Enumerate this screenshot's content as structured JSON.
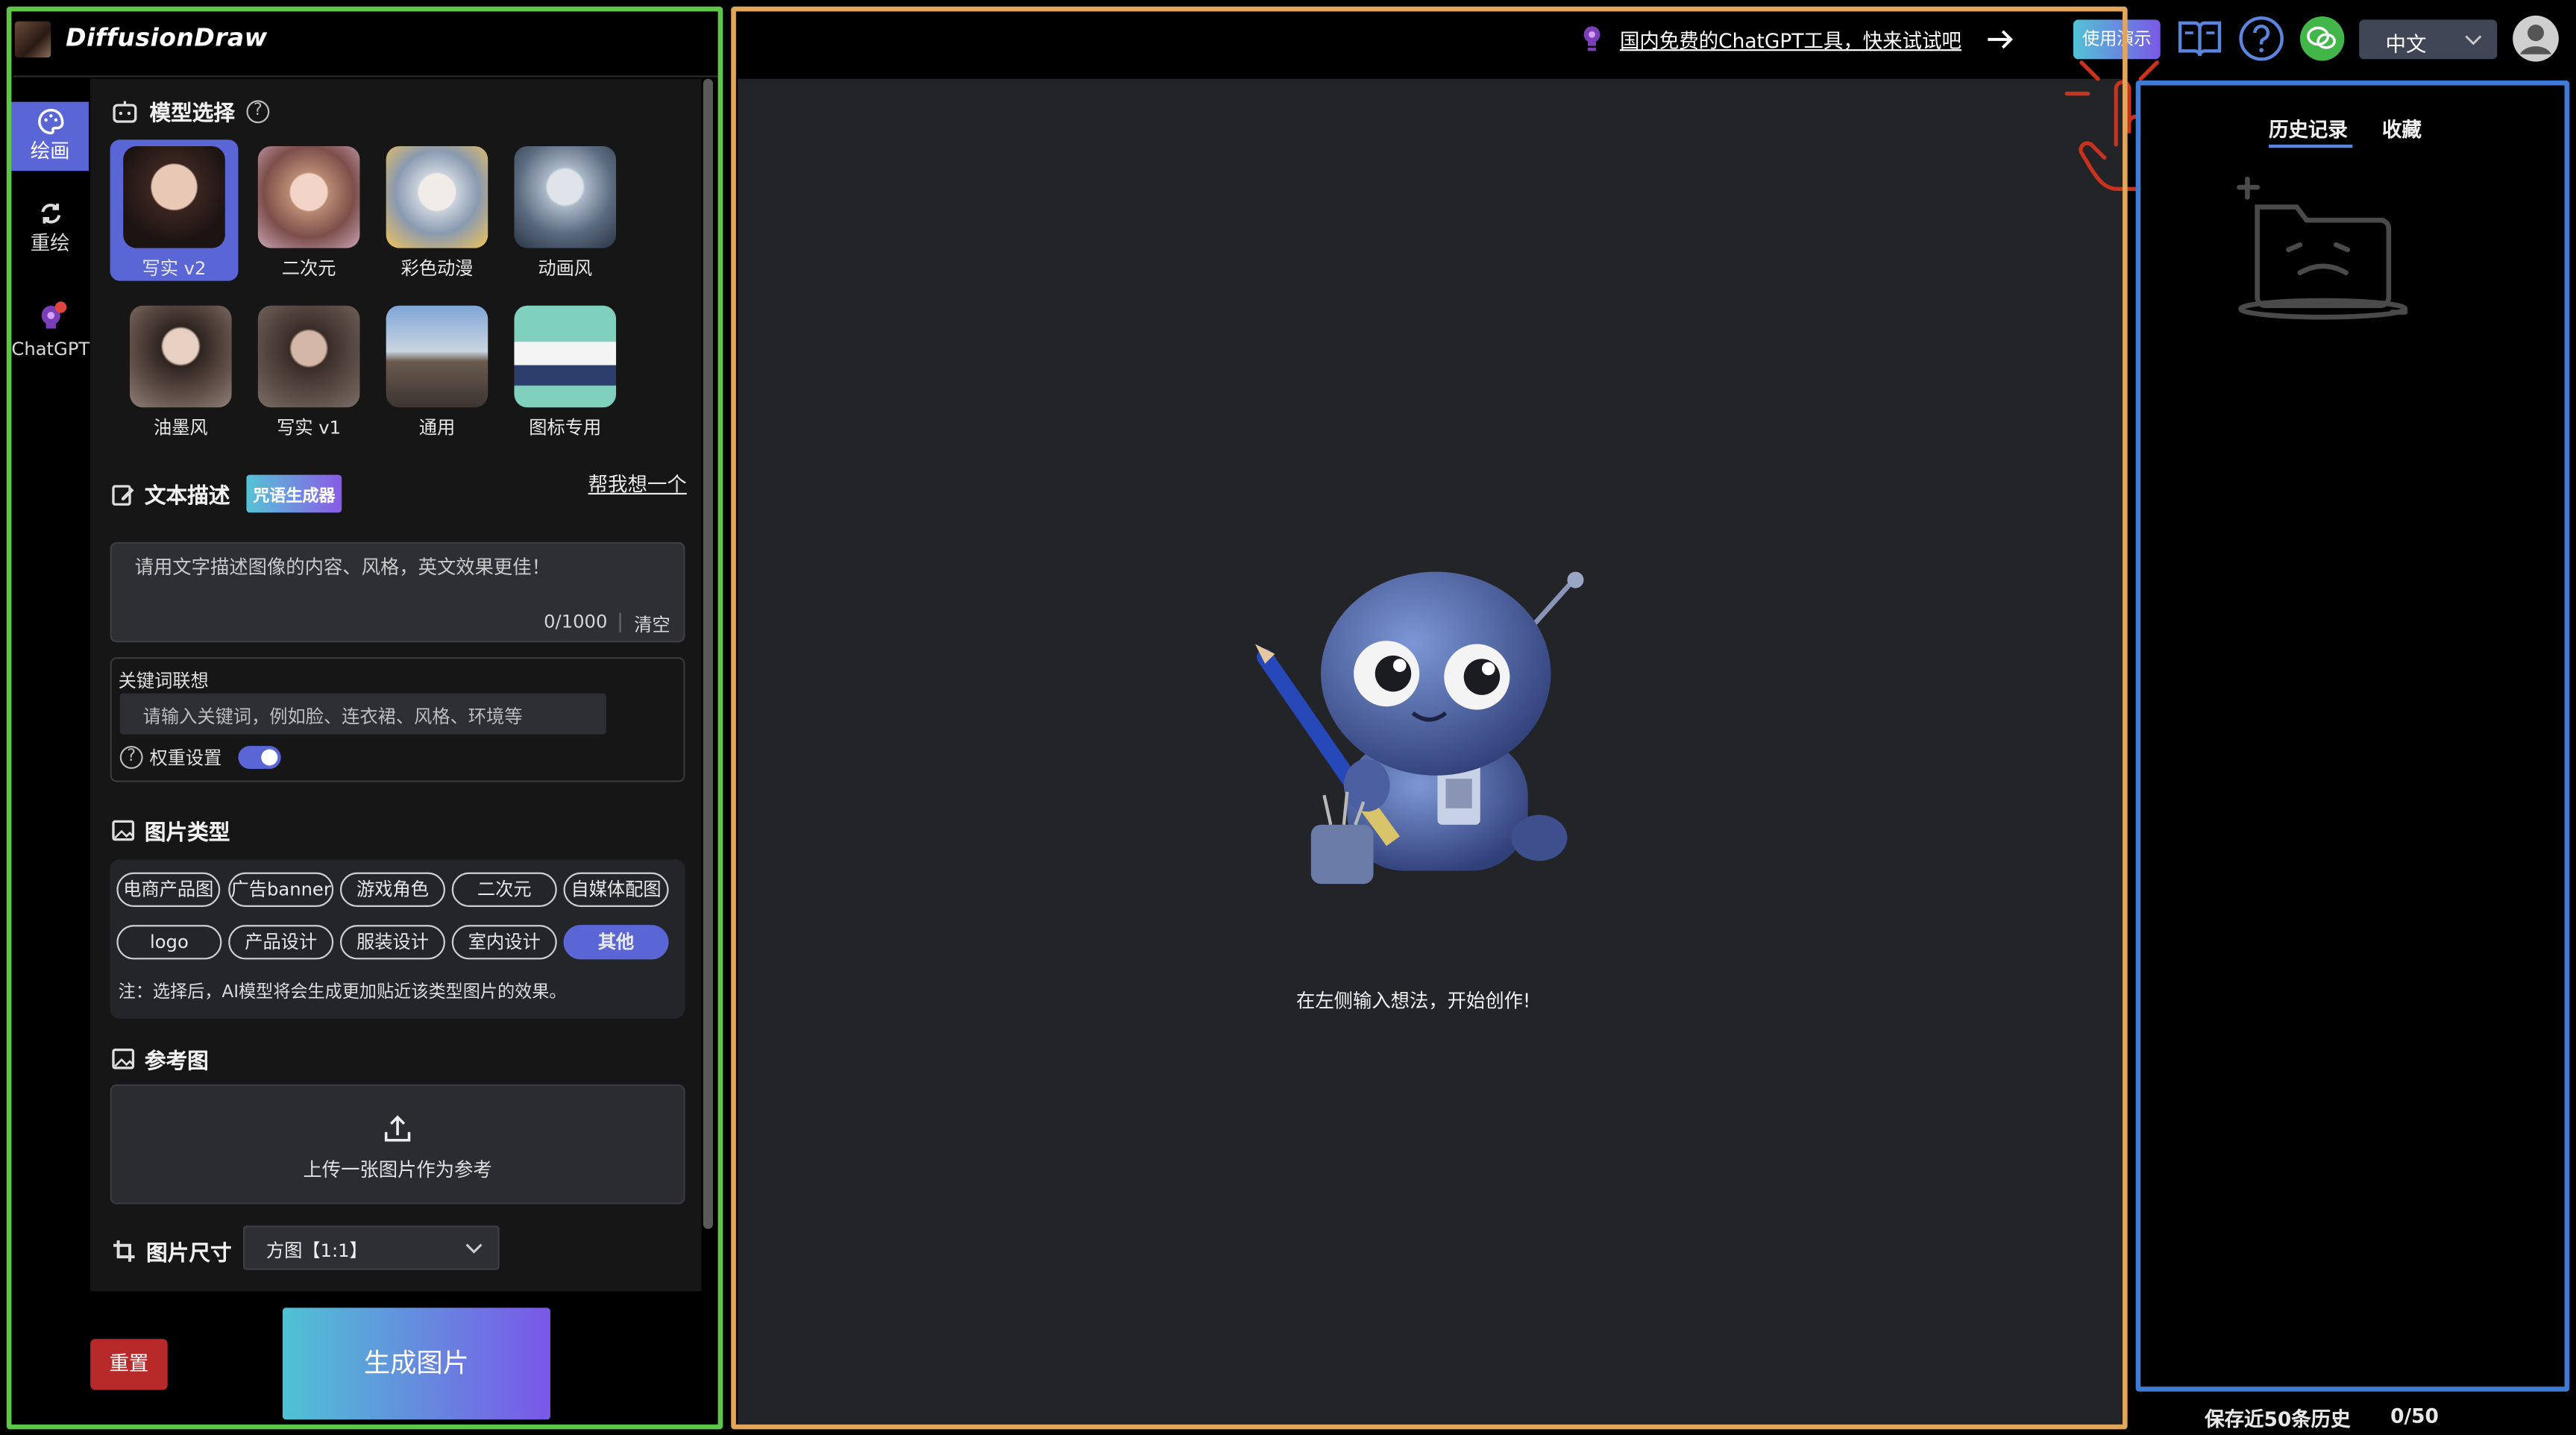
{
  "app": {
    "title": "DiffusionDraw"
  },
  "topbar": {
    "promo": "国内免费的ChatGPT工具，快来试试吧",
    "demo_button": "使用演示",
    "language": "中文"
  },
  "rail": {
    "items": [
      {
        "label": "绘画",
        "icon": "palette-icon"
      },
      {
        "label": "重绘",
        "icon": "refresh-icon"
      },
      {
        "label": "ChatGPT",
        "icon": "bulb-icon"
      }
    ]
  },
  "model_select": {
    "title": "模型选择",
    "models": [
      {
        "label": "写实 v2",
        "selected": true,
        "color": "#3b2a26"
      },
      {
        "label": "二次元",
        "color": "#c69a8c"
      },
      {
        "label": "彩色动漫",
        "color": "#b7c4d4"
      },
      {
        "label": "动画风",
        "color": "#7c8ca0"
      },
      {
        "label": "油墨风",
        "color": "#6b5a52"
      },
      {
        "label": "写实 v1",
        "color": "#4a3d38"
      },
      {
        "label": "通用",
        "color": "#8a9cb8"
      },
      {
        "label": "图标专用",
        "color": "#5fb7a4"
      }
    ]
  },
  "text_desc": {
    "title": "文本描述",
    "badge": "咒语生成器",
    "help_link": "帮我想一个",
    "placeholder": "请用文字描述图像的内容、风格，英文效果更佳！",
    "counter": "0/1000",
    "clear": "清空"
  },
  "keywords": {
    "title": "关键词联想",
    "placeholder": "请输入关键词，例如脸、连衣裙、风格、环境等",
    "weight_label": "权重设置",
    "weight_on": true
  },
  "image_type": {
    "title": "图片类型",
    "tags": [
      "电商产品图",
      "广告banner",
      "游戏角色",
      "二次元",
      "自媒体配图",
      "logo",
      "产品设计",
      "服装设计",
      "室内设计",
      "其他"
    ],
    "selected": "其他",
    "note": "注：选择后，AI模型将会生成更加贴近该类型图片的效果。"
  },
  "reference": {
    "title": "参考图",
    "upload_label": "上传一张图片作为参考"
  },
  "size": {
    "title": "图片尺寸",
    "value": "方图【1:1】"
  },
  "actions": {
    "reset": "重置",
    "generate": "生成图片"
  },
  "canvas": {
    "hint": "在左侧输入想法，开始创作!"
  },
  "history": {
    "tab_history": "历史记录",
    "tab_favorites": "收藏",
    "footer_label": "保存近50条历史",
    "footer_count": "0/50"
  },
  "colors": {
    "accent": "#5b66d6",
    "green": "#5ec64a",
    "orange": "#e2a65a",
    "blue": "#3f7bd6",
    "danger": "#b82a2a"
  }
}
